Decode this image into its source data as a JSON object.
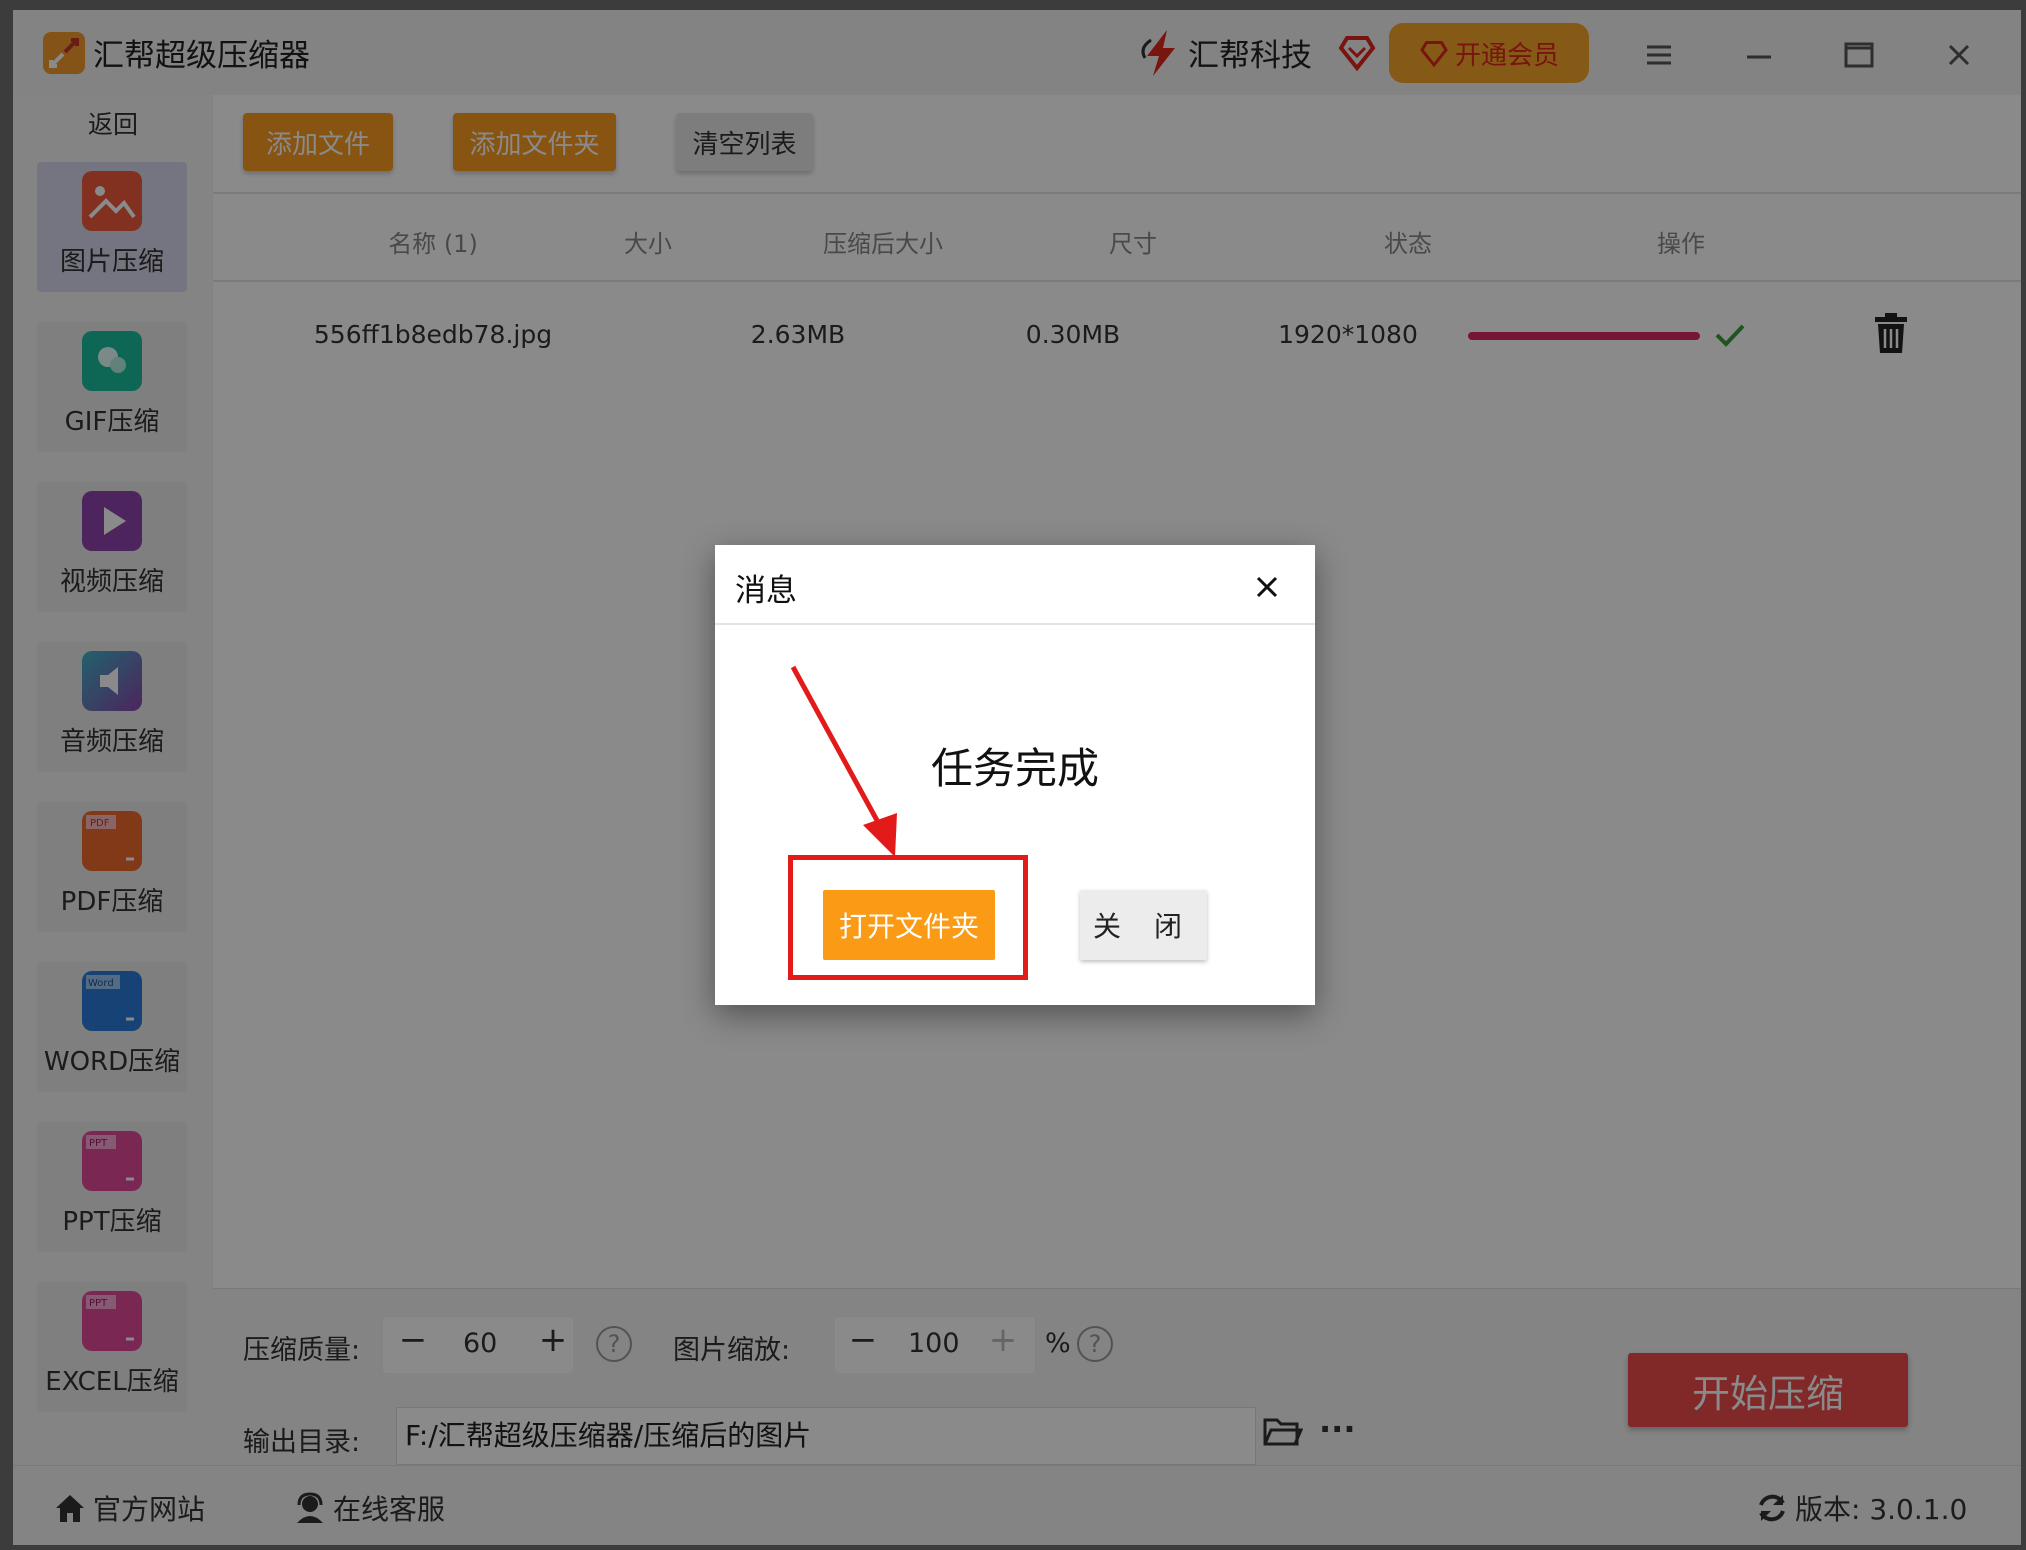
{
  "app": {
    "title": "汇帮超级压缩器",
    "brand": "汇帮科技",
    "vip_label": "开通会员"
  },
  "sidebar": {
    "back": "返回",
    "items": [
      {
        "label": "图片压缩",
        "icon": "image-icon",
        "color": "#f05a3c"
      },
      {
        "label": "GIF压缩",
        "icon": "gif-icon",
        "color": "#1abc9c"
      },
      {
        "label": "视频压缩",
        "icon": "video-icon",
        "color": "#8e44ad"
      },
      {
        "label": "音频压缩",
        "icon": "audio-icon",
        "color": "#3fb4c8"
      },
      {
        "label": "PDF压缩",
        "icon": "pdf-icon",
        "color": "#f06a2c"
      },
      {
        "label": "WORD压缩",
        "icon": "word-icon",
        "color": "#2b7bd8"
      },
      {
        "label": "PPT压缩",
        "icon": "ppt-icon",
        "color": "#e24a9a"
      },
      {
        "label": "EXCEL压缩",
        "icon": "excel-icon",
        "color": "#e24a9a"
      }
    ]
  },
  "toolbar": {
    "add_file": "添加文件",
    "add_folder": "添加文件夹",
    "clear_list": "清空列表"
  },
  "table": {
    "headers": [
      "名称 (1)",
      "大小",
      "压缩后大小",
      "尺寸",
      "状态",
      "操作"
    ],
    "rows": [
      {
        "name": "556ff1b8edb78.jpg",
        "size": "2.63MB",
        "compressed_size": "0.30MB",
        "dimensions": "1920*1080",
        "progress": 1.0
      }
    ]
  },
  "settings": {
    "quality_label": "压缩质量:",
    "quality_value": "60",
    "scale_label": "图片缩放:",
    "scale_value": "100",
    "percent": "%",
    "output_label": "输出目录:",
    "output_path": "F:/汇帮超级压缩器/压缩后的图片",
    "more": "···",
    "start": "开始压缩"
  },
  "footer": {
    "website": "官方网站",
    "support": "在线客服",
    "version": "版本: 3.0.1.0"
  },
  "dialog": {
    "title": "消息",
    "message": "任务完成",
    "open_folder": "打开文件夹",
    "close": "关 闭"
  },
  "colors": {
    "accent_orange": "#fa9b22",
    "start_red": "#ef4a4d",
    "progress_pink": "#e0266a",
    "annotation_red": "#e31a1a"
  }
}
